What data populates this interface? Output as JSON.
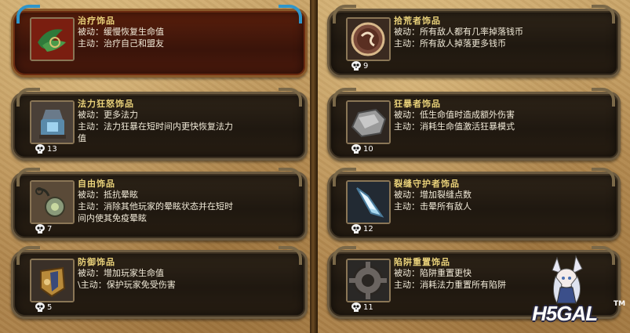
{
  "cards": [
    {
      "id": "heal",
      "name": "治疗饰品",
      "passive": "被动：缓慢恢复生命值",
      "active": "主动：治疗自己和盟友",
      "active_cont": "",
      "cost": "",
      "selected": true,
      "icon": "leaf-amulet-icon"
    },
    {
      "id": "mana",
      "name": "法力狂怒饰品",
      "passive": "被动：更多法力",
      "active": "主动：法力狂暴在短时间内更快恢复法力",
      "active_cont": "值",
      "cost": "13",
      "selected": false,
      "icon": "mana-lantern-icon"
    },
    {
      "id": "freedom",
      "name": "自由饰品",
      "passive": "被动：抵抗晕眩",
      "active": "主动：消除其他玩家的晕眩状态并在短时",
      "active_cont": "间内使其免疫晕眩",
      "cost": "7",
      "selected": false,
      "icon": "freedom-pendant-icon"
    },
    {
      "id": "defense",
      "name": "防御饰品",
      "passive": "被动：增加玩家生命值",
      "active": "\\主动：保护玩家免受伤害",
      "active_cont": "",
      "cost": "5",
      "selected": false,
      "icon": "shield-amulet-icon"
    },
    {
      "id": "scavenger",
      "name": "拾荒者饰品",
      "passive": "被动：所有敌人都有几率掉落钱币",
      "active": "主动：所有敌人掉落更多钱币",
      "active_cont": "",
      "cost": "9",
      "selected": false,
      "icon": "coin-rune-icon"
    },
    {
      "id": "berserker",
      "name": "狂暴者饰品",
      "passive": "被动：低生命值时造成额外伤害",
      "active": "主动：消耗生命值激活狂暴模式",
      "active_cont": "",
      "cost": "10",
      "selected": false,
      "icon": "rage-stone-icon"
    },
    {
      "id": "rift",
      "name": "裂缝守护者饰品",
      "passive": "被动：增加裂缝点数",
      "active": "主动：击晕所有敌人",
      "active_cont": "",
      "cost": "12",
      "selected": false,
      "icon": "crystal-shard-icon"
    },
    {
      "id": "trap",
      "name": "陷阱重置饰品",
      "passive": "被动：陷阱重置更快",
      "active": "主动：消耗法力重置所有陷阱",
      "active_cont": "",
      "cost": "11",
      "selected": false,
      "icon": "gear-trap-icon"
    }
  ],
  "watermark": "H5GAL",
  "trademark": "TM"
}
